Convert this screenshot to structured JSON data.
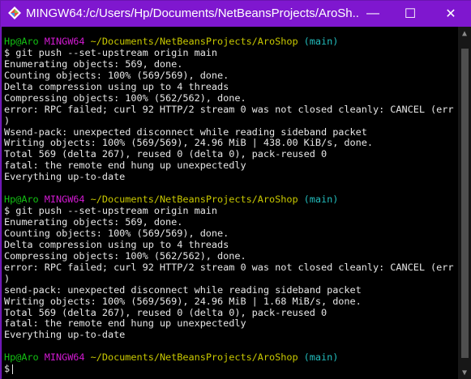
{
  "window": {
    "title": "MINGW64:/c/Users/Hp/Documents/NetBeansProjects/AroSh...",
    "controls": {
      "minimize": "—",
      "maximize": "☐",
      "close": "✕"
    }
  },
  "terminal": {
    "prompt": {
      "user": "Hp@Aro",
      "shell": "MINGW64",
      "path": "~/Documents/NetBeansProjects/AroShop",
      "branch": "(main)",
      "symbol": "$"
    },
    "first_command": "git push --set-upstream origin main",
    "first_output": [
      "Enumerating objects: 569, done.",
      "Counting objects: 100% (569/569), done.",
      "Delta compression using up to 4 threads",
      "Compressing objects: 100% (562/562), done.",
      "error: RPC failed; curl 92 HTTP/2 stream 0 was not closed cleanly: CANCEL (err 8",
      ")",
      "Wsend-pack: unexpected disconnect while reading sideband packet",
      "Writing objects: 100% (569/569), 24.96 MiB | 438.00 KiB/s, done.",
      "Total 569 (delta 267), reused 0 (delta 0), pack-reused 0",
      "fatal: the remote end hung up unexpectedly",
      "Everything up-to-date"
    ],
    "second_command": "git push --set-upstream origin main",
    "second_output": [
      "Enumerating objects: 569, done.",
      "Counting objects: 100% (569/569), done.",
      "Delta compression using up to 4 threads",
      "Compressing objects: 100% (562/562), done.",
      "error: RPC failed; curl 92 HTTP/2 stream 0 was not closed cleanly: CANCEL (err 8",
      ")",
      "send-pack: unexpected disconnect while reading sideband packet",
      "Writing objects: 100% (569/569), 24.96 MiB | 1.68 MiB/s, done.",
      "Total 569 (delta 267), reused 0 (delta 0), pack-reused 0",
      "fatal: the remote end hung up unexpectedly",
      "Everything up-to-date"
    ]
  },
  "colors": {
    "titlebar": "#7f17cf",
    "prompt_user": "#13c113",
    "prompt_shell": "#d11ad1",
    "prompt_path": "#c8c800",
    "prompt_branch": "#22bcbc"
  },
  "icons": {
    "app": "mingw-terminal-icon",
    "scroll_up": "triangle-up-icon",
    "scroll_down": "triangle-down-icon"
  }
}
